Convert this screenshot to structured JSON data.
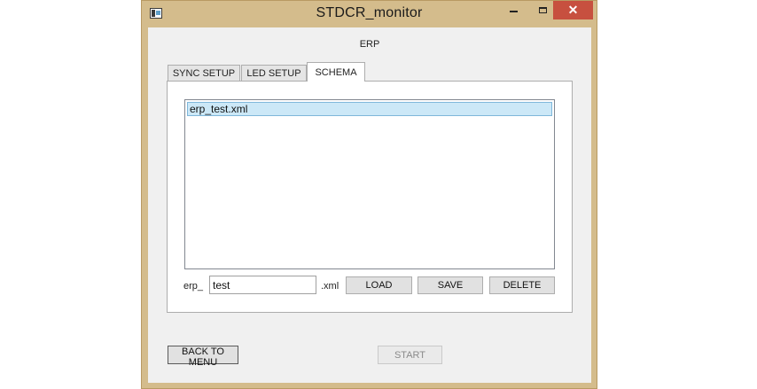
{
  "window": {
    "title": "STDCR_monitor"
  },
  "header": {
    "label": "ERP"
  },
  "tabs": [
    {
      "label": "SYNC SETUP",
      "active": false
    },
    {
      "label": "LED SETUP",
      "active": false
    },
    {
      "label": "SCHEMA",
      "active": true
    }
  ],
  "schema": {
    "files": [
      {
        "name": "erp_test.xml",
        "selected": true
      }
    ],
    "prefix": "erp_",
    "name_value": "test",
    "suffix": ".xml",
    "load_label": "LOAD",
    "save_label": "SAVE",
    "delete_label": "DELETE"
  },
  "footer": {
    "back_label": "BACK TO MENU",
    "start_label": "START",
    "start_enabled": false
  },
  "colors": {
    "frame": "#d4bc8c",
    "close": "#c7503f",
    "selection": "#cce8f7"
  }
}
